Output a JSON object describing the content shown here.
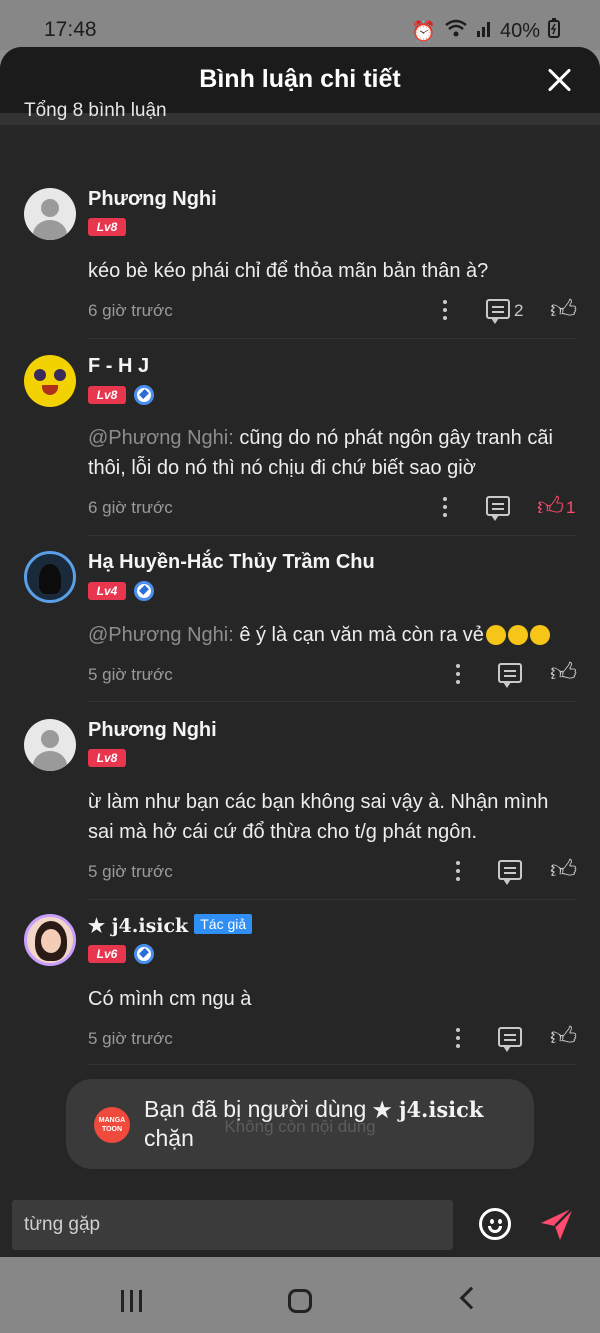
{
  "status_bar": {
    "time": "17:48",
    "battery": "40%"
  },
  "sheet": {
    "title": "Bình luận chi tiết"
  },
  "total_label": "Tổng 8 bình luận",
  "comments": [
    {
      "name": "Phương Nghi",
      "level": "Lv8",
      "mention": "",
      "text": "kéo bè kéo phái chỉ để thỏa mãn bản thân à?",
      "time": "6 giờ trước",
      "reply_count": "2",
      "like_count": ""
    },
    {
      "name": "F - H J",
      "level": "Lv8",
      "mention": "@Phương Nghi:",
      "text": " cũng do nó phát ngôn gây tranh cãi thôi, lỗi do nó thì nó chịu đi chứ biết sao giờ",
      "time": "6 giờ trước",
      "reply_count": "",
      "like_count": "1"
    },
    {
      "name": "Hạ Huyền-Hắc Thủy Trầm Chu",
      "level": "Lv4",
      "mention": "@Phương Nghi:",
      "text": " ê ý là cạn văn mà còn ra vẻ",
      "time": "5 giờ trước",
      "reply_count": "",
      "like_count": ""
    },
    {
      "name": "Phương Nghi",
      "level": "Lv8",
      "mention": "",
      "text": "ừ làm như bạn các bạn không sai vậy à. Nhận mình sai mà hở cái cứ đổ thừa cho t/g phát ngôn.",
      "time": "5 giờ trước",
      "reply_count": "",
      "like_count": ""
    },
    {
      "name": "★ j4.isick",
      "author_tag": "Tác giả",
      "level": "Lv6",
      "mention": "",
      "text": "Có mình cm ngu à",
      "time": "5 giờ trước",
      "reply_count": "",
      "like_count": ""
    }
  ],
  "toast": {
    "logo": "MANGA TOON",
    "text_prefix": "Bạn đã bị người dùng ",
    "blocked_user": "★ j4.isick",
    "text_suffix": "chặn",
    "underlying": "Không còn nội dung"
  },
  "input": {
    "value": "từng gặp",
    "faint_text": "· · ·  ·  · · ·"
  },
  "colors": {
    "accent": "#ff4b6e",
    "level_badge": "#e8364f",
    "author_tag": "#2f8ff5"
  }
}
